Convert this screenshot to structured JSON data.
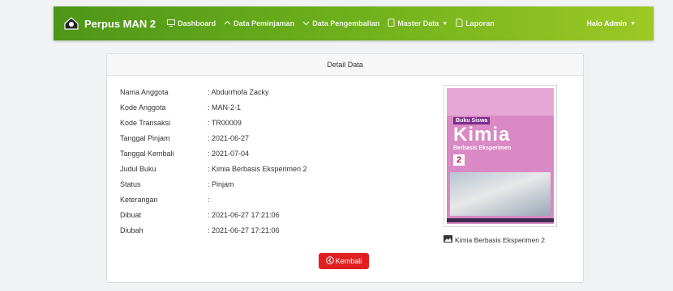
{
  "brand": {
    "name": "Perpus MAN 2"
  },
  "nav": {
    "items": [
      {
        "label": "Dashboard",
        "icon": "monitor-icon"
      },
      {
        "label": "Data Peminjaman",
        "icon": "chevron-up-icon"
      },
      {
        "label": "Data Pengembalian",
        "icon": "chevron-down-icon"
      },
      {
        "label": "Master Data",
        "icon": "book-icon"
      },
      {
        "label": "Laporan",
        "icon": "document-icon"
      }
    ],
    "user": "Halo Admin"
  },
  "card": {
    "header": "Detail Data",
    "rows": [
      {
        "label": "Nama Anggota",
        "value": ": Abdurrhofa Zacky"
      },
      {
        "label": "Kode Anggota",
        "value": ": MAN-2-1"
      },
      {
        "label": "Kode Transaksi",
        "value": ": TR00009"
      },
      {
        "label": "Tanggal Pinjam",
        "value": ": 2021-06-27"
      },
      {
        "label": "Tanggal Kembali",
        "value": ": 2021-07-04"
      },
      {
        "label": "Judul Buku",
        "value": ": Kimia Berbasis Eksperimen 2"
      },
      {
        "label": "Status",
        "value": ": Pinjam"
      },
      {
        "label": "Keterangan",
        "value": ":"
      },
      {
        "label": "Dibuat",
        "value": ": 2021-06-27 17:21:06"
      },
      {
        "label": "Diubah",
        "value": ": 2021-06-27 17:21:06"
      }
    ],
    "book_cover": {
      "badge": "Buku Siswa",
      "title": "Kimia",
      "subtitle": "Berbasis Eksperimen",
      "volume": "2"
    },
    "book_caption": "Kimia Berbasis Eksperimen 2",
    "back_button": "Kembali"
  },
  "colors": {
    "navbar_start": "#4d9618",
    "navbar_end": "#9cc925",
    "danger": "#e02020"
  }
}
